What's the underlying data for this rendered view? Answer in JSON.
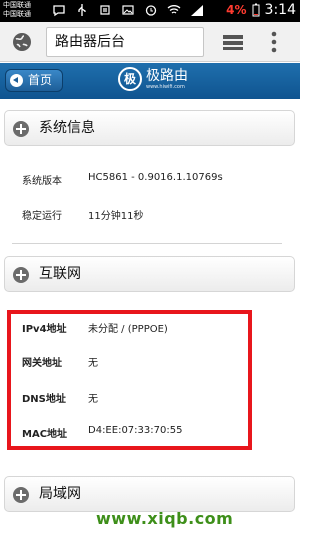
{
  "status_bar": {
    "carrier_1": "中国联通",
    "carrier_2": "中国联通",
    "battery": "4%",
    "time": "3:14",
    "icons": [
      "message-icon",
      "usb-icon",
      "cleanup-icon",
      "photo-icon",
      "alarm-icon",
      "wifi-icon",
      "signal-icon"
    ]
  },
  "browser": {
    "url_text": "路由器后台",
    "icons": [
      "globe-icon",
      "tabs-icon",
      "overflow-menu-icon"
    ]
  },
  "app_header": {
    "home_label": "首页",
    "logo_name": "极路由",
    "logo_url": "www.hiwifi.com",
    "accent": "#1565a5"
  },
  "sections": {
    "system": {
      "title": "系统信息",
      "rows": [
        {
          "label": "系统版本",
          "value": "HC5861 - 0.9016.1.10769s"
        },
        {
          "label": "稳定运行",
          "value": "11分钟11秒"
        }
      ]
    },
    "internet": {
      "title": "互联网",
      "rows": [
        {
          "label": "IPv4地址",
          "value": "未分配 / (PPPOE)"
        },
        {
          "label": "网关地址",
          "value": "无"
        },
        {
          "label": "DNS地址",
          "value": "无"
        },
        {
          "label": "MAC地址",
          "value": "D4:EE:07:33:70:55"
        }
      ]
    },
    "lan": {
      "title": "局域网"
    }
  },
  "highlight_color": "#e8161c",
  "watermark": "www.xiqb.com"
}
